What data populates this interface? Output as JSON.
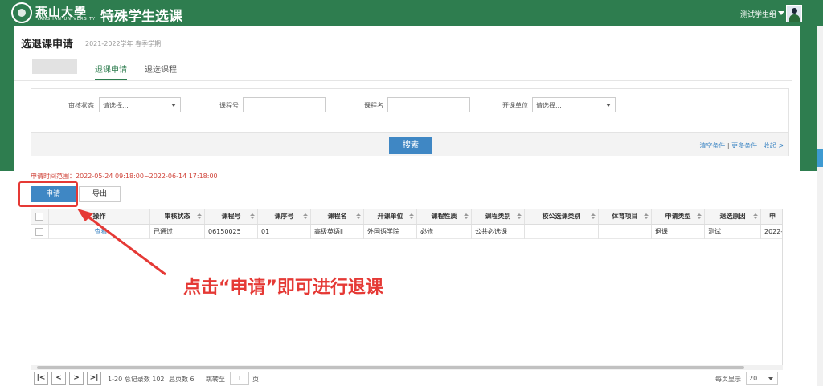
{
  "header": {
    "school_name": "燕山大學",
    "school_en": "YANSHAN UNIVERSITY",
    "system_title": "特殊学生选课",
    "user": "测试学生组"
  },
  "page": {
    "title": "选退课申请",
    "subtitle": "2021-2022学年 春季学期"
  },
  "tabs": [
    {
      "label": "退课申请",
      "active": true
    },
    {
      "label": "退选课程",
      "active": false
    }
  ],
  "filter": {
    "audit_label": "审核状态",
    "audit_value": "请选择...",
    "course_no_label": "课程号",
    "course_no_value": "",
    "course_name_label": "课程名",
    "course_name_value": "",
    "dept_label": "开课单位",
    "dept_value": "请选择...",
    "search": "搜索",
    "clear": "清空条件",
    "sep": "|",
    "more": "更多条件",
    "collapse": "收起 >"
  },
  "range_text": "申请时间范围：2022-05-24 09:18:00~2022-06-14 17:18:00",
  "actions": {
    "apply": "申请",
    "export": "导出"
  },
  "table": {
    "headers": [
      "操作",
      "审核状态",
      "课程号",
      "课序号",
      "课程名",
      "开课单位",
      "课程性质",
      "课程类别",
      "校公选课类别",
      "体育项目",
      "申请类型",
      "退选原因",
      "申"
    ],
    "rows": [
      [
        "查看",
        "已通过",
        "06150025",
        "01",
        "高级英语Ⅱ",
        "外国语学院",
        "必修",
        "公共必选课",
        "",
        "",
        "退课",
        "测试",
        "2022-"
      ]
    ]
  },
  "pager": {
    "first": "|<",
    "prev": "<",
    "next": ">",
    "last": ">|",
    "summary": "1-20 总记录数 102",
    "pages": "总页数 6",
    "jump": "跳转至",
    "page_value": "1",
    "page_unit": "页",
    "per_page_label": "每页显示",
    "per_page": "20"
  },
  "annotation": "点击“申请”即可进行退课",
  "colors": {
    "brand_green": "#2e7d4f",
    "button_blue": "#3f87c4",
    "annotation_red": "#e53935"
  }
}
